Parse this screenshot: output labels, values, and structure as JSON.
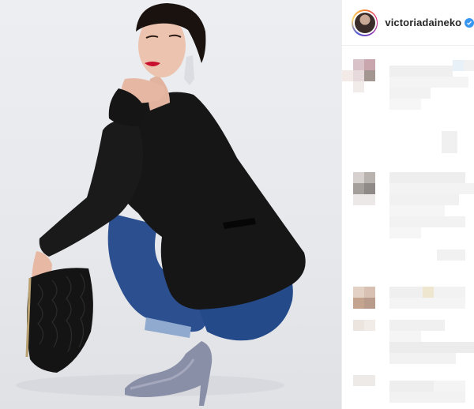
{
  "post": {
    "username": "victoriadaineko",
    "verified": true
  },
  "colors": {
    "accent_blue": "#3897f0",
    "jacket": "#151515",
    "jeans": "#2b4f8f",
    "lips": "#c8102e",
    "background": "#e8eaee"
  },
  "icons": {
    "verified": "verified-badge-icon"
  },
  "comments": {
    "pixelated": true,
    "count": 4
  }
}
